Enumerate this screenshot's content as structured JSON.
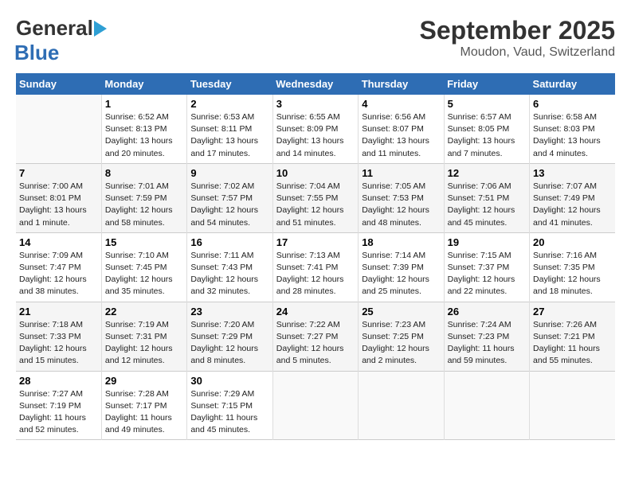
{
  "header": {
    "logo_line1": "General",
    "logo_line2": "Blue",
    "month": "September 2025",
    "location": "Moudon, Vaud, Switzerland"
  },
  "weekdays": [
    "Sunday",
    "Monday",
    "Tuesday",
    "Wednesday",
    "Thursday",
    "Friday",
    "Saturday"
  ],
  "weeks": [
    [
      {
        "num": "",
        "info": ""
      },
      {
        "num": "1",
        "info": "Sunrise: 6:52 AM\nSunset: 8:13 PM\nDaylight: 13 hours\nand 20 minutes."
      },
      {
        "num": "2",
        "info": "Sunrise: 6:53 AM\nSunset: 8:11 PM\nDaylight: 13 hours\nand 17 minutes."
      },
      {
        "num": "3",
        "info": "Sunrise: 6:55 AM\nSunset: 8:09 PM\nDaylight: 13 hours\nand 14 minutes."
      },
      {
        "num": "4",
        "info": "Sunrise: 6:56 AM\nSunset: 8:07 PM\nDaylight: 13 hours\nand 11 minutes."
      },
      {
        "num": "5",
        "info": "Sunrise: 6:57 AM\nSunset: 8:05 PM\nDaylight: 13 hours\nand 7 minutes."
      },
      {
        "num": "6",
        "info": "Sunrise: 6:58 AM\nSunset: 8:03 PM\nDaylight: 13 hours\nand 4 minutes."
      }
    ],
    [
      {
        "num": "7",
        "info": "Sunrise: 7:00 AM\nSunset: 8:01 PM\nDaylight: 13 hours\nand 1 minute."
      },
      {
        "num": "8",
        "info": "Sunrise: 7:01 AM\nSunset: 7:59 PM\nDaylight: 12 hours\nand 58 minutes."
      },
      {
        "num": "9",
        "info": "Sunrise: 7:02 AM\nSunset: 7:57 PM\nDaylight: 12 hours\nand 54 minutes."
      },
      {
        "num": "10",
        "info": "Sunrise: 7:04 AM\nSunset: 7:55 PM\nDaylight: 12 hours\nand 51 minutes."
      },
      {
        "num": "11",
        "info": "Sunrise: 7:05 AM\nSunset: 7:53 PM\nDaylight: 12 hours\nand 48 minutes."
      },
      {
        "num": "12",
        "info": "Sunrise: 7:06 AM\nSunset: 7:51 PM\nDaylight: 12 hours\nand 45 minutes."
      },
      {
        "num": "13",
        "info": "Sunrise: 7:07 AM\nSunset: 7:49 PM\nDaylight: 12 hours\nand 41 minutes."
      }
    ],
    [
      {
        "num": "14",
        "info": "Sunrise: 7:09 AM\nSunset: 7:47 PM\nDaylight: 12 hours\nand 38 minutes."
      },
      {
        "num": "15",
        "info": "Sunrise: 7:10 AM\nSunset: 7:45 PM\nDaylight: 12 hours\nand 35 minutes."
      },
      {
        "num": "16",
        "info": "Sunrise: 7:11 AM\nSunset: 7:43 PM\nDaylight: 12 hours\nand 32 minutes."
      },
      {
        "num": "17",
        "info": "Sunrise: 7:13 AM\nSunset: 7:41 PM\nDaylight: 12 hours\nand 28 minutes."
      },
      {
        "num": "18",
        "info": "Sunrise: 7:14 AM\nSunset: 7:39 PM\nDaylight: 12 hours\nand 25 minutes."
      },
      {
        "num": "19",
        "info": "Sunrise: 7:15 AM\nSunset: 7:37 PM\nDaylight: 12 hours\nand 22 minutes."
      },
      {
        "num": "20",
        "info": "Sunrise: 7:16 AM\nSunset: 7:35 PM\nDaylight: 12 hours\nand 18 minutes."
      }
    ],
    [
      {
        "num": "21",
        "info": "Sunrise: 7:18 AM\nSunset: 7:33 PM\nDaylight: 12 hours\nand 15 minutes."
      },
      {
        "num": "22",
        "info": "Sunrise: 7:19 AM\nSunset: 7:31 PM\nDaylight: 12 hours\nand 12 minutes."
      },
      {
        "num": "23",
        "info": "Sunrise: 7:20 AM\nSunset: 7:29 PM\nDaylight: 12 hours\nand 8 minutes."
      },
      {
        "num": "24",
        "info": "Sunrise: 7:22 AM\nSunset: 7:27 PM\nDaylight: 12 hours\nand 5 minutes."
      },
      {
        "num": "25",
        "info": "Sunrise: 7:23 AM\nSunset: 7:25 PM\nDaylight: 12 hours\nand 2 minutes."
      },
      {
        "num": "26",
        "info": "Sunrise: 7:24 AM\nSunset: 7:23 PM\nDaylight: 11 hours\nand 59 minutes."
      },
      {
        "num": "27",
        "info": "Sunrise: 7:26 AM\nSunset: 7:21 PM\nDaylight: 11 hours\nand 55 minutes."
      }
    ],
    [
      {
        "num": "28",
        "info": "Sunrise: 7:27 AM\nSunset: 7:19 PM\nDaylight: 11 hours\nand 52 minutes."
      },
      {
        "num": "29",
        "info": "Sunrise: 7:28 AM\nSunset: 7:17 PM\nDaylight: 11 hours\nand 49 minutes."
      },
      {
        "num": "30",
        "info": "Sunrise: 7:29 AM\nSunset: 7:15 PM\nDaylight: 11 hours\nand 45 minutes."
      },
      {
        "num": "",
        "info": ""
      },
      {
        "num": "",
        "info": ""
      },
      {
        "num": "",
        "info": ""
      },
      {
        "num": "",
        "info": ""
      }
    ]
  ]
}
